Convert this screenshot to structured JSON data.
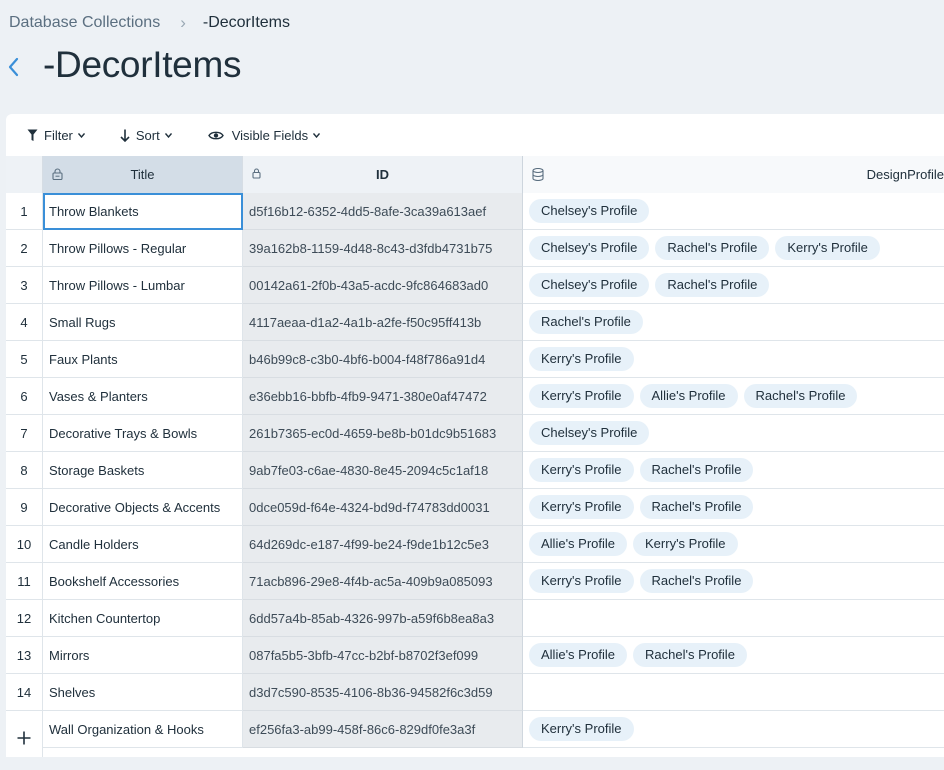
{
  "breadcrumb": {
    "root": "Database Collections",
    "current": "-DecorItems"
  },
  "page": {
    "title": "-DecorItems"
  },
  "toolbar": {
    "filter": "Filter",
    "sort": "Sort",
    "visible_fields": "Visible Fields"
  },
  "columns": {
    "title": "Title",
    "id": "ID",
    "design_profile": "DesignProfile"
  },
  "icons": {
    "back": "chevron-left-icon",
    "filter": "funnel-icon",
    "sort": "arrow-down-icon",
    "visible": "eye-icon",
    "lock": "lock-icon",
    "reference": "database-icon",
    "add": "plus-icon"
  },
  "colors": {
    "accent": "#3a8fd8",
    "tag_bg": "#e7f1f9",
    "id_col_bg": "#e8ebee",
    "page_bg": "#edf1f5"
  },
  "rows": [
    {
      "num": "1",
      "title": "Throw Blankets",
      "id": "d5f16b12-6352-4dd5-8afe-3ca39a613aef",
      "profiles": [
        "Chelsey's Profile"
      ]
    },
    {
      "num": "2",
      "title": "Throw Pillows - Regular",
      "id": "39a162b8-1159-4d48-8c43-d3fdb4731b75",
      "profiles": [
        "Chelsey's Profile",
        "Rachel's Profile",
        "Kerry's Profile"
      ]
    },
    {
      "num": "3",
      "title": "Throw Pillows - Lumbar",
      "id": "00142a61-2f0b-43a5-acdc-9fc864683ad0",
      "profiles": [
        "Chelsey's Profile",
        "Rachel's Profile"
      ]
    },
    {
      "num": "4",
      "title": "Small Rugs",
      "id": "4117aeaa-d1a2-4a1b-a2fe-f50c95ff413b",
      "profiles": [
        "Rachel's Profile"
      ]
    },
    {
      "num": "5",
      "title": "Faux Plants",
      "id": "b46b99c8-c3b0-4bf6-b004-f48f786a91d4",
      "profiles": [
        "Kerry's Profile"
      ]
    },
    {
      "num": "6",
      "title": "Vases & Planters",
      "id": "e36ebb16-bbfb-4fb9-9471-380e0af47472",
      "profiles": [
        "Kerry's Profile",
        "Allie's Profile",
        "Rachel's Profile"
      ]
    },
    {
      "num": "7",
      "title": "Decorative Trays & Bowls",
      "id": "261b7365-ec0d-4659-be8b-b01dc9b51683",
      "profiles": [
        "Chelsey's Profile"
      ]
    },
    {
      "num": "8",
      "title": "Storage Baskets",
      "id": "9ab7fe03-c6ae-4830-8e45-2094c5c1af18",
      "profiles": [
        "Kerry's Profile",
        "Rachel's Profile"
      ]
    },
    {
      "num": "9",
      "title": "Decorative Objects & Accents",
      "id": "0dce059d-f64e-4324-bd9d-f74783dd0031",
      "profiles": [
        "Kerry's Profile",
        "Rachel's Profile"
      ]
    },
    {
      "num": "10",
      "title": "Candle Holders",
      "id": "64d269dc-e187-4f99-be24-f9de1b12c5e3",
      "profiles": [
        "Allie's Profile",
        "Kerry's Profile"
      ]
    },
    {
      "num": "11",
      "title": "Bookshelf Accessories",
      "id": "71acb896-29e8-4f4b-ac5a-409b9a085093",
      "profiles": [
        "Kerry's Profile",
        "Rachel's Profile"
      ]
    },
    {
      "num": "12",
      "title": "Kitchen Countertop",
      "id": "6dd57a4b-85ab-4326-997b-a59f6b8ea8a3",
      "profiles": []
    },
    {
      "num": "13",
      "title": "Mirrors",
      "id": "087fa5b5-3bfb-47cc-b2bf-b8702f3ef099",
      "profiles": [
        "Allie's Profile",
        "Rachel's Profile"
      ]
    },
    {
      "num": "14",
      "title": "Shelves",
      "id": "d3d7c590-8535-4106-8b36-94582f6c3d59",
      "profiles": []
    },
    {
      "num": "15",
      "title": "Wall Organization & Hooks",
      "id": "ef256fa3-ab99-458f-86c6-829df0fe3a3f",
      "profiles": [
        "Kerry's Profile"
      ]
    }
  ]
}
